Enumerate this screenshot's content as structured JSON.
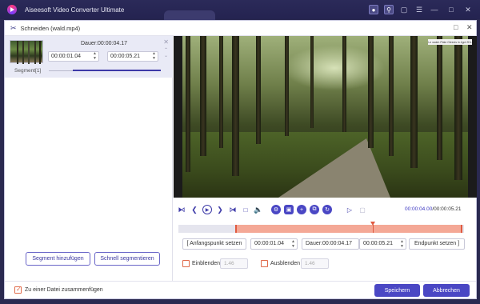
{
  "app": {
    "title": "Aiseesoft Video Converter Ultimate",
    "icons": [
      "user-icon",
      "key-icon",
      "chat-icon",
      "menu-icon"
    ],
    "window_controls": [
      "—",
      "□",
      "✕"
    ]
  },
  "dialog": {
    "title": "Schneiden (wald.mp4)",
    "segment": {
      "label": "Segment[1]",
      "duration": "Dauer:00:00:04.17",
      "start": "00:00:01.04",
      "end": "00:00:05.21"
    },
    "left_buttons": {
      "add_segment": "Segment hinzufügen",
      "quick_split": "Schnell segmentieren"
    },
    "preview": {
      "watermark": "Le watch Plate Gleevis in 4gol 2DL"
    },
    "playback": {
      "current_time": "00:00:04.00",
      "total_time": "/00:00:05.21"
    },
    "timeline": {
      "selection_start_fraction": 0.2,
      "playhead_fraction": 0.68
    },
    "set_row": {
      "set_start": "Anfangspunkt setzen",
      "start_value": "00:00:01.04",
      "duration_value": "Dauer:00:00:04.17",
      "end_value": "00:00:05.21",
      "set_end": "Endpunkt setzen",
      "bracket_left": "[",
      "bracket_right": "]"
    },
    "fade": {
      "fade_in_label": "Einblenden",
      "fade_in_value": "1.46",
      "fade_out_label": "Ausblenden",
      "fade_out_value": "1.46"
    },
    "footer": {
      "merge_label": "Zu einer Datei zusammenfügen",
      "merge_checked": true,
      "save": "Speichern",
      "cancel": "Abbrechen"
    }
  },
  "colors": {
    "accent": "#4a47c4",
    "selection": "#e05a40",
    "titlebar": "#2b2a59"
  }
}
